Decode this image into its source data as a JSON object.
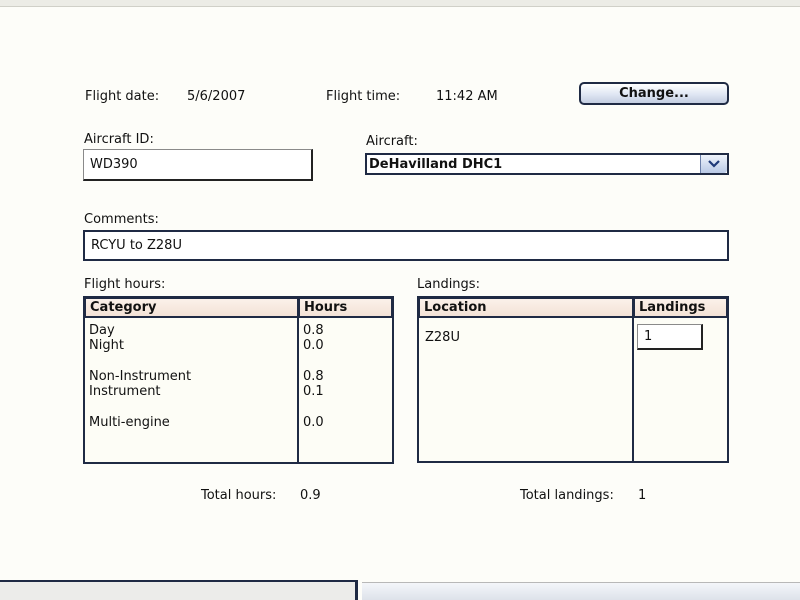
{
  "header": {
    "flight_date_label": "Flight date:",
    "flight_date_value": "5/6/2007",
    "flight_time_label": "Flight time:",
    "flight_time_value": "11:42 AM",
    "change_button": "Change..."
  },
  "aircraft_id": {
    "label": "Aircraft ID:",
    "value": "WD390"
  },
  "aircraft": {
    "label": "Aircraft:",
    "selected": "DeHavilland DHC1"
  },
  "comments": {
    "label": "Comments:",
    "value": "RCYU to Z28U"
  },
  "flight_hours": {
    "label": "Flight hours:",
    "columns": [
      "Category",
      "Hours"
    ],
    "rows": [
      {
        "category": "Day",
        "hours": "0.8"
      },
      {
        "category": "Night",
        "hours": "0.0"
      },
      {
        "category": "Non-Instrument",
        "hours": "0.8"
      },
      {
        "category": "Instrument",
        "hours": "0.1"
      },
      {
        "category": "Multi-engine",
        "hours": "0.0"
      }
    ],
    "total_label": "Total hours:",
    "total_value": "0.9"
  },
  "landings": {
    "label": "Landings:",
    "columns": [
      "Location",
      "Landings"
    ],
    "rows": [
      {
        "location": "Z28U",
        "landings": "1"
      }
    ],
    "total_label": "Total landings:",
    "total_value": "1"
  },
  "colors": {
    "border": "#1f2a44",
    "header_fill": "#f6e8de",
    "background": "#fdfdf9"
  }
}
